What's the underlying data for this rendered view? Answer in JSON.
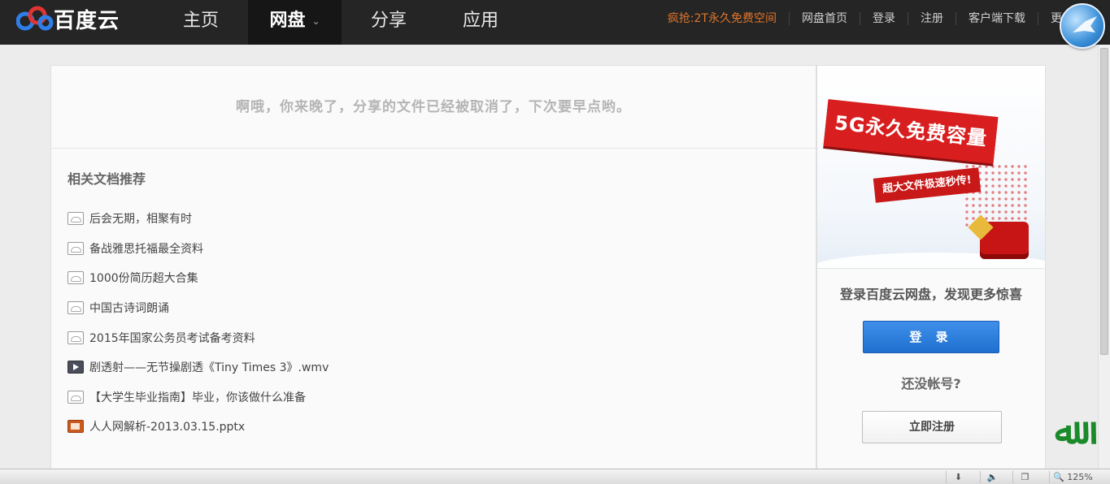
{
  "logo": {
    "text": "百度云"
  },
  "nav": {
    "items": [
      {
        "label": "主页"
      },
      {
        "label": "网盘"
      },
      {
        "label": "分享"
      },
      {
        "label": "应用"
      }
    ],
    "caret": "⌄"
  },
  "toplinks": {
    "promo": "疯抢:2T永久免费空间",
    "home": "网盘首页",
    "login": "登录",
    "register": "注册",
    "client": "客户端下载",
    "more": "更多"
  },
  "notice": "啊哦，你来晚了，分享的文件已经被取消了，下次要早点哟。",
  "related": {
    "title": "相关文档推荐",
    "items": [
      {
        "label": "后会无期，相聚有时",
        "icon": "cloud-file-icon"
      },
      {
        "label": "备战雅思托福最全资料",
        "icon": "cloud-file-icon"
      },
      {
        "label": "1000份简历超大合集",
        "icon": "cloud-file-icon"
      },
      {
        "label": "中国古诗词朗诵",
        "icon": "cloud-file-icon"
      },
      {
        "label": "2015年国家公务员考试备考资料",
        "icon": "cloud-file-icon"
      },
      {
        "label": "剧透射——无节操剧透《Tiny Times 3》.wmv",
        "icon": "video-file-icon"
      },
      {
        "label": "【大学生毕业指南】毕业，你该做什么准备",
        "icon": "cloud-file-icon"
      },
      {
        "label": "人人网解析-2013.03.15.pptx",
        "icon": "ppt-file-icon"
      }
    ]
  },
  "sidebar": {
    "ad_headline": "5G永久免费容量",
    "ad_tagline": "超大文件极速秒传!",
    "title": "登录百度云网盘，发现更多惊喜",
    "login_label": "登 录",
    "no_account": "还没帐号?",
    "register_label": "立即注册"
  },
  "statusbar": {
    "zoom": "125%"
  },
  "colors": {
    "nav_bg": "#252525",
    "promo": "#e0752a",
    "primary_button": "#1f6fd0",
    "ad_red": "#d81e1e"
  }
}
